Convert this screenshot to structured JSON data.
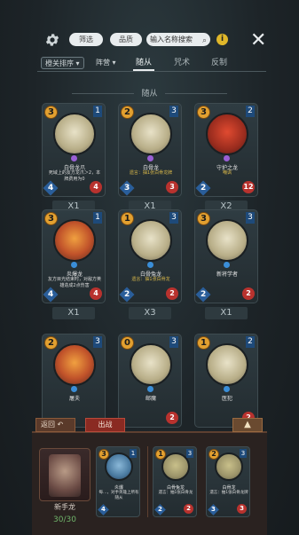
{
  "toolbar": {
    "filter_a": "筛选",
    "filter_b": "品质",
    "search_placeholder": "输入名称搜索",
    "info_label": "i",
    "close_label": "✕"
  },
  "filters": {
    "sort_label": "橙关排序",
    "lineage_label": "阵营",
    "tabs": [
      {
        "label": "随从",
        "active": true
      },
      {
        "label": "咒术",
        "active": false
      },
      {
        "label": "反制",
        "active": false
      }
    ]
  },
  "section_title": "随从",
  "cards": [
    {
      "cost": "3",
      "rank": "1",
      "name": "白骨龙爪",
      "desc": "死域上的友方龙爪＞2，本牌费用为0",
      "attack": "4",
      "health": "4",
      "count": "X1",
      "art": "pale",
      "gem": "purple",
      "desc_color": "white"
    },
    {
      "cost": "2",
      "rank": "3",
      "name": "白骨龙",
      "desc": "遗言：抽1张白骨龙牌",
      "attack": "3",
      "health": "3",
      "count": "X1",
      "art": "pale",
      "gem": "purple",
      "desc_color": "gold"
    },
    {
      "cost": "3",
      "rank": "2",
      "name": "守护之龙",
      "desc": "嘲讽",
      "attack": "2",
      "health": "12",
      "count": "X2",
      "art": "red",
      "gem": "purple",
      "desc_color": "gold"
    },
    {
      "cost": "3",
      "rank": "1",
      "name": "炎爆龙",
      "desc": "友方目光结束时，对敌方英雄造成2点伤害",
      "attack": "4",
      "health": "4",
      "count": "X1",
      "art": "fire",
      "gem": "blue",
      "desc_color": "white"
    },
    {
      "cost": "1",
      "rank": "3",
      "name": "白骨兔龙",
      "desc": "遗言：抽1张白骨龙",
      "attack": "2",
      "health": "2",
      "count": "X3",
      "art": "pale",
      "gem": "blue",
      "desc_color": "gold"
    },
    {
      "cost": "3",
      "rank": "3",
      "name": "新将学者",
      "desc": "",
      "attack": "2",
      "health": "2",
      "count": "X1",
      "art": "pale",
      "gem": "blue",
      "desc_color": "white"
    },
    {
      "cost": "2",
      "rank": "3",
      "name": "屠夫",
      "desc": "",
      "attack": "",
      "health": "",
      "count": "",
      "art": "fire",
      "gem": "blue",
      "desc_color": "white"
    },
    {
      "cost": "0",
      "rank": "3",
      "name": "邮魔",
      "desc": "",
      "attack": "",
      "health": "2",
      "count": "",
      "art": "pale",
      "gem": "blue",
      "desc_color": "white"
    },
    {
      "cost": "1",
      "rank": "2",
      "name": "医犯",
      "desc": "",
      "attack": "",
      "health": "2",
      "count": "",
      "art": "pale",
      "gem": "blue",
      "desc_color": "white"
    }
  ],
  "bottom": {
    "back_label": "返回 ↶",
    "battle_label": "出战",
    "expand_label": "▲",
    "hero_name": "新手龙",
    "hero_count": "30/30",
    "deck": [
      {
        "cost": "3",
        "rank": "1",
        "name": "炎爆",
        "desc": "每…，对手英雄上所有随从",
        "attack": "4",
        "health": "",
        "art": "blue"
      },
      {
        "cost": "1",
        "rank": "3",
        "name": "白骨兔龙",
        "desc": "遗言：抽1张白骨龙",
        "attack": "2",
        "health": "2",
        "art": "pale"
      },
      {
        "cost": "2",
        "rank": "3",
        "name": "白骨龙",
        "desc": "遗言：抽1张白骨龙牌",
        "attack": "3",
        "health": "3",
        "art": "pale"
      }
    ]
  }
}
